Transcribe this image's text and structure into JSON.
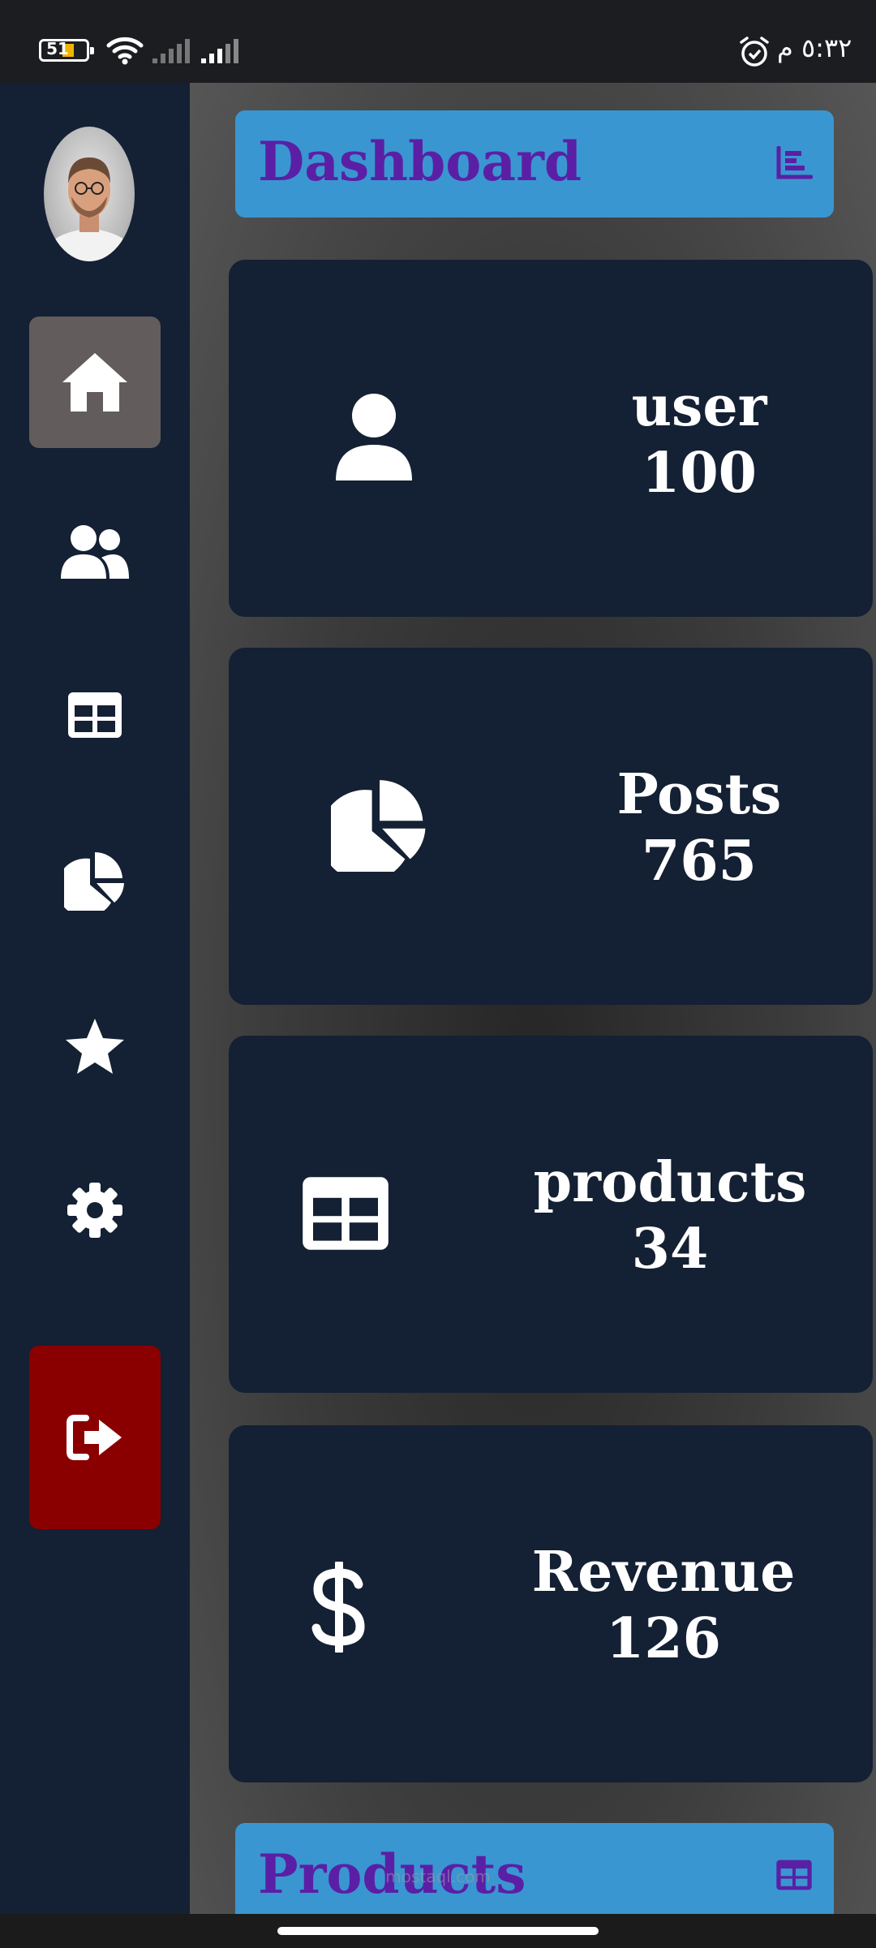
{
  "status_bar": {
    "battery_level": "51",
    "time": "٥:٣٢ م"
  },
  "sidebar": {
    "items": [
      {
        "icon": "home-icon",
        "active": true
      },
      {
        "icon": "users-icon",
        "active": false
      },
      {
        "icon": "table-icon",
        "active": false
      },
      {
        "icon": "pie-chart-icon",
        "active": false
      },
      {
        "icon": "star-icon",
        "active": false
      },
      {
        "icon": "gear-icon",
        "active": false
      },
      {
        "icon": "logout-icon",
        "active": false
      }
    ]
  },
  "header": {
    "title": "Dashboard",
    "icon": "bar-chart-icon"
  },
  "cards": [
    {
      "label": "user",
      "value": "100",
      "icon": "user-icon"
    },
    {
      "label": "Posts",
      "value": "765",
      "icon": "pie-chart-icon"
    },
    {
      "label": "products",
      "value": "34",
      "icon": "table-icon"
    },
    {
      "label": "Revenue",
      "value": "126",
      "icon": "dollar-icon"
    }
  ],
  "section": {
    "title": "Products",
    "icon": "table-icon"
  },
  "watermark": "mostaql.com",
  "colors": {
    "sidebar_bg": "#142033",
    "active_nav": "#625c5c",
    "logout": "#8a0000",
    "header_bg": "#3a96d0",
    "header_text": "#5b1fa6"
  }
}
